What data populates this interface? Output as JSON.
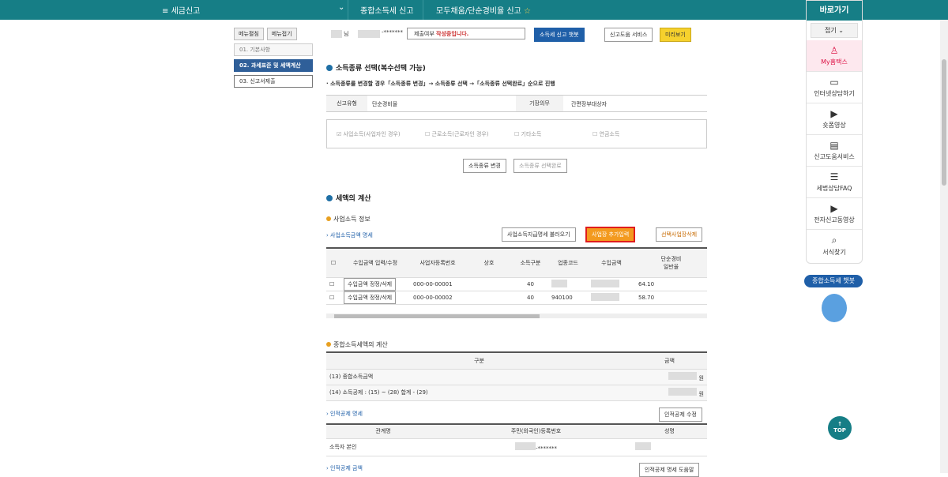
{
  "header": {
    "menu": "세금신고",
    "crumb1": "종합소득세 신고",
    "crumb2": "모두채움/단순경비율 신고"
  },
  "sidebar": {
    "btn_expand": "메뉴펼침",
    "btn_collapse": "메뉴접기",
    "items": [
      "01. 기본사항",
      "02. 과세표준 및 세액계산",
      "03. 신고서제출"
    ]
  },
  "status": {
    "name_suffix": "님",
    "masked": "-*******",
    "submit_label": "제출여부",
    "submit_value": "작성중입니다.",
    "chatbot": "소득세 신고 챗봇",
    "help": "신고도움 서비스",
    "preview": "미리보기"
  },
  "income_type": {
    "title": "소득종류 선택(복수선택 가능)",
    "note": "· 소득종류를 변경할 경우「소득종류 변경」→ 소득종류 선택 →「소득종류 선택완료」순으로 진행",
    "report_type_label": "신고유형",
    "report_type_value": "단순경비율",
    "bookkeeping_label": "기장의무",
    "bookkeeping_value": "간편장부대상자",
    "options": [
      "사업소득(사업자인 경우)",
      "근로소득(근로자인 경우)",
      "기타소득",
      "연금소득"
    ],
    "change_btn": "소득종류 변경",
    "done_btn": "소득종류 선택완료"
  },
  "tax_calc": {
    "title": "세액의 계산",
    "biz_info": "사업소득 정보",
    "biz_detail": "사업소득금액 명세",
    "load_btn": "사업소득지급명세 불러오기",
    "add_btn": "사업장 추가입력",
    "del_btn": "선택사업장삭제",
    "cols": [
      "수입금액 입력/수정",
      "사업자등록번호",
      "상호",
      "소득구분",
      "업종코드",
      "수입금액",
      "단순경비",
      "일반율"
    ],
    "rows": [
      {
        "edit": "수입금액 정정/삭제",
        "reg": "000-00-00001",
        "type": "40",
        "code": "",
        "rate": "64.10"
      },
      {
        "edit": "수입금액 정정/삭제",
        "reg": "000-00-00002",
        "type": "40",
        "code": "940100",
        "rate": "58.70"
      }
    ]
  },
  "total": {
    "title": "종합소득세액의 계산",
    "col1": "구분",
    "col2": "금액",
    "row1": "(13) 종합소득금액",
    "row2": "(14) 소득공제 : (15) ~ (28) 합계 - (29)",
    "unit": "원"
  },
  "deduction": {
    "title": "인적공제 명세",
    "edit_btn": "인적공제 수정",
    "col1": "관계명",
    "col2": "주민(외국인)등록번호",
    "col3": "성명",
    "rel": "소득자 본인",
    "ssn": "-*******",
    "amount_title": "인적공제 금액",
    "help_btn": "인적공제 명세 도움말"
  },
  "right": {
    "title": "바로가기",
    "fold": "접기",
    "items": [
      "My홈택스",
      "인터넷상담하기",
      "숏폼영상",
      "신고도움서비스",
      "세법상담FAQ",
      "전자신고동영상",
      "서식찾기"
    ],
    "chatbot": "종합소득세 챗봇",
    "top": "TOP"
  }
}
